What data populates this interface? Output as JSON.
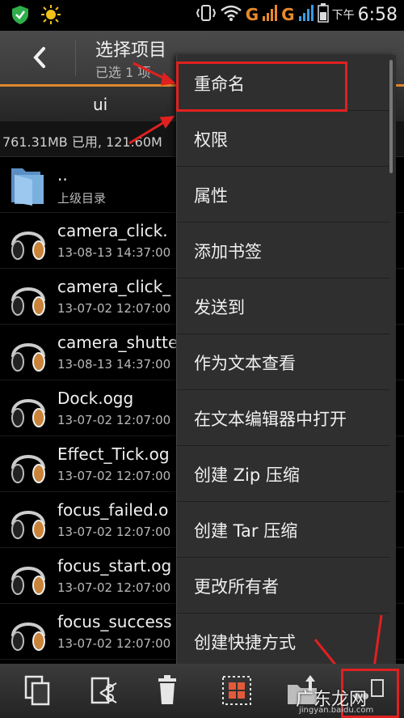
{
  "status": {
    "network_label_1": "G",
    "network_label_2": "G",
    "ampm": "下午",
    "time": "6:58"
  },
  "header": {
    "title": "选择项目",
    "subtitle": "已选 1 项"
  },
  "path": {
    "current_folder": "ui",
    "storage": "761.31MB 已用, 121.60M"
  },
  "files": [
    {
      "name": "..",
      "meta": "上级目录",
      "icon": "folder-icon"
    },
    {
      "name": "camera_click.",
      "meta": "13-08-13 14:37:00",
      "icon": "headphones-icon"
    },
    {
      "name": "camera_click_",
      "meta": "13-07-02 12:07:00",
      "icon": "headphones-icon"
    },
    {
      "name": "camera_shutte",
      "meta": "13-08-13 14:37:00",
      "icon": "headphones-icon"
    },
    {
      "name": "Dock.ogg",
      "meta": "13-07-02 12:07:00",
      "icon": "headphones-icon"
    },
    {
      "name": "Effect_Tick.og",
      "meta": "13-07-02 12:07:00",
      "icon": "headphones-icon"
    },
    {
      "name": "focus_failed.o",
      "meta": "13-07-02 12:07:00",
      "icon": "headphones-icon"
    },
    {
      "name": "focus_start.og",
      "meta": "13-07-02 12:07:00",
      "icon": "headphones-icon"
    },
    {
      "name": "focus_success",
      "meta": "13-07-02 12:07:00",
      "icon": "headphones-icon"
    }
  ],
  "menu": {
    "items": [
      "重命名",
      "权限",
      "属性",
      "添加书签",
      "发送到",
      "作为文本查看",
      "在文本编辑器中打开",
      "创建 Zip 压缩",
      "创建 Tar 压缩",
      "更改所有者",
      "创建快捷方式"
    ]
  },
  "toolbar": {
    "buttons": [
      "copy-icon",
      "cut-icon",
      "delete-icon",
      "select-all-icon",
      "upload-icon",
      "more-icon"
    ]
  },
  "watermark": {
    "text": "广东龙网",
    "sub": "jingyan.baidu.com"
  },
  "colors": {
    "accent_orange": "#e0862a",
    "annotation_red": "#e02020",
    "menu_bg": "#2f2f2f"
  }
}
